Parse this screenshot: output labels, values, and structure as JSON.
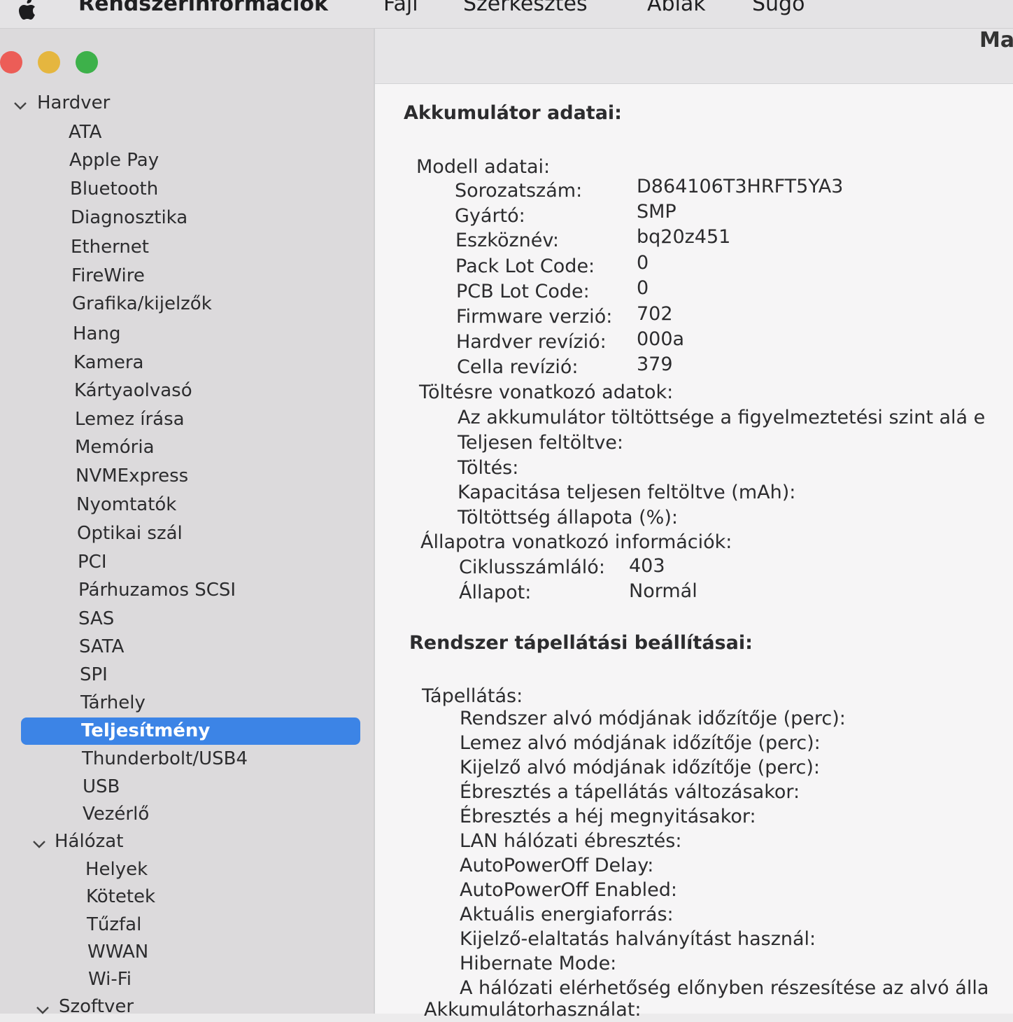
{
  "menubar": {
    "app_name": "Rendszerinformációk",
    "items": [
      "Fájl",
      "Szerkesztés",
      "Ablak",
      "Súgó"
    ]
  },
  "header": {
    "title_fragment": "Ma"
  },
  "sidebar": {
    "hardware": {
      "label": "Hardver",
      "items": [
        "ATA",
        "Apple Pay",
        "Bluetooth",
        "Diagnosztika",
        "Ethernet",
        "FireWire",
        "Grafika/kijelzők",
        "Hang",
        "Kamera",
        "Kártyaolvasó",
        "Lemez írása",
        "Memória",
        "NVMExpress",
        "Nyomtatók",
        "Optikai szál",
        "PCI",
        "Párhuzamos SCSI",
        "SAS",
        "SATA",
        "SPI",
        "Tárhely",
        "Teljesítmény",
        "Thunderbolt/USB4",
        "USB",
        "Vezérlő"
      ],
      "selected": "Teljesítmény"
    },
    "network": {
      "label": "Hálózat",
      "items": [
        "Helyek",
        "Kötetek",
        "Tűzfal",
        "WWAN",
        "Wi-Fi"
      ]
    },
    "software": {
      "label": "Szoftver"
    }
  },
  "battery": {
    "heading": "Akkumulátor adatai:",
    "model_section": "Modell adatai:",
    "model_rows": [
      {
        "label": "Sorozatszám:",
        "value": "D864106T3HRFT5YA3"
      },
      {
        "label": "Gyártó:",
        "value": "SMP"
      },
      {
        "label": "Eszköznév:",
        "value": "bq20z451"
      },
      {
        "label": "Pack Lot Code:",
        "value": "0"
      },
      {
        "label": "PCB Lot Code:",
        "value": "0"
      },
      {
        "label": "Firmware verzió:",
        "value": "702"
      },
      {
        "label": "Hardver revízió:",
        "value": "000a"
      },
      {
        "label": "Cella revízió:",
        "value": "379"
      }
    ],
    "charge_section": "Töltésre vonatkozó adatok:",
    "charge_rows": [
      "Az akkumulátor töltöttsége a figyelmeztetési szint alá e",
      "Teljesen feltöltve:",
      "Töltés:",
      "Kapacitása teljesen feltöltve (mAh):",
      "Töltöttség állapota (%):"
    ],
    "status_section": "Állapotra vonatkozó információk:",
    "status_rows": [
      {
        "label": "Ciklusszámláló:",
        "value": "403"
      },
      {
        "label": "Állapot:",
        "value": "Normál"
      }
    ]
  },
  "power": {
    "heading": "Rendszer tápellátási beállításai:",
    "section": "Tápellátás:",
    "rows": [
      "Rendszer alvó módjának időzítője (perc):",
      "Lemez alvó módjának időzítője (perc):",
      "Kijelző alvó módjának időzítője (perc):",
      "Ébresztés a tápellátás változásakor:",
      "Ébresztés a héj megnyitásakor:",
      "LAN hálózati ébresztés:",
      "AutoPowerOff Delay:",
      "AutoPowerOff Enabled:",
      "Aktuális energiaforrás:",
      "Kijelző-elaltatás halványítást használ:",
      "Hibernate Mode:",
      "A hálózati elérhetőség előnyben részesítése az alvó álla"
    ],
    "next_section": "Akkumulátorhasználat:"
  },
  "colors": {
    "selection": "#3c84e6",
    "sidebar_bg": "#dcdadc",
    "content_bg": "#f6f5f6"
  }
}
